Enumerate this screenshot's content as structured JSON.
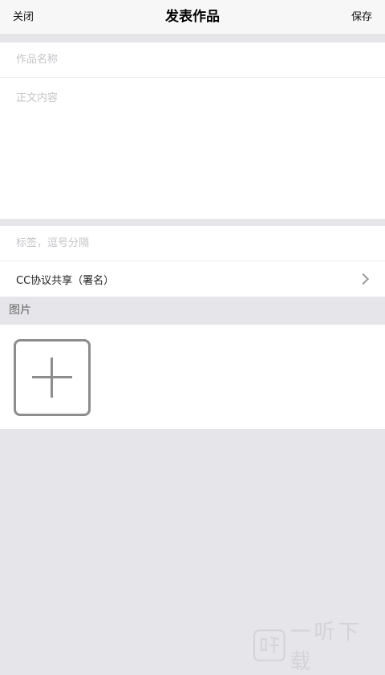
{
  "navbar": {
    "close_label": "关闭",
    "title": "发表作品",
    "save_label": "保存"
  },
  "form": {
    "title_placeholder": "作品名称",
    "body_placeholder": "正文内容",
    "tags_placeholder": "标签，逗号分隔",
    "license_label": "CC协议共享（署名）"
  },
  "images": {
    "section_title": "图片"
  },
  "watermark": {
    "text": "一听下载"
  }
}
